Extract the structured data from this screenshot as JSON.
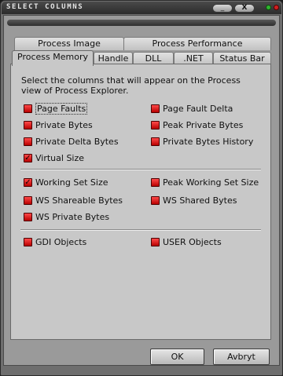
{
  "window": {
    "title": "SELECT COLUMNS",
    "minimize_label": "_",
    "close_label": "X"
  },
  "tabs": {
    "back_row": [
      "Process Image",
      "Process Performance"
    ],
    "front_row": [
      "Process Memory",
      "Handle",
      "DLL",
      ".NET",
      "Status Bar"
    ],
    "active": "Process Memory"
  },
  "description": "Select the columns that will appear on the Process view of Process Explorer.",
  "groups": [
    {
      "items": [
        {
          "label": "Page Faults",
          "checked": false
        },
        {
          "label": "Page Fault Delta",
          "checked": false
        },
        {
          "label": "Private Bytes",
          "checked": false
        },
        {
          "label": "Peak Private Bytes",
          "checked": false
        },
        {
          "label": "Private Delta Bytes",
          "checked": false
        },
        {
          "label": "Private Bytes History",
          "checked": false
        },
        {
          "label": "Virtual Size",
          "checked": true
        }
      ]
    },
    {
      "items": [
        {
          "label": "Working Set Size",
          "checked": true
        },
        {
          "label": "Peak Working Set Size",
          "checked": false
        },
        {
          "label": "WS Shareable Bytes",
          "checked": false
        },
        {
          "label": "WS Shared Bytes",
          "checked": false
        },
        {
          "label": "WS Private Bytes",
          "checked": false
        }
      ]
    },
    {
      "items": [
        {
          "label": "GDI Objects",
          "checked": false
        },
        {
          "label": "USER Objects",
          "checked": false
        }
      ]
    }
  ],
  "buttons": {
    "ok": "OK",
    "cancel": "Avbryt"
  },
  "colors": {
    "checkbox": "#e01e1e",
    "window_bg": "#6e6e6e",
    "panel_bg": "#c8c8c8"
  },
  "icons": {
    "check_mark": "check-mark-icon",
    "minimize": "minimize-icon",
    "close": "close-icon"
  }
}
